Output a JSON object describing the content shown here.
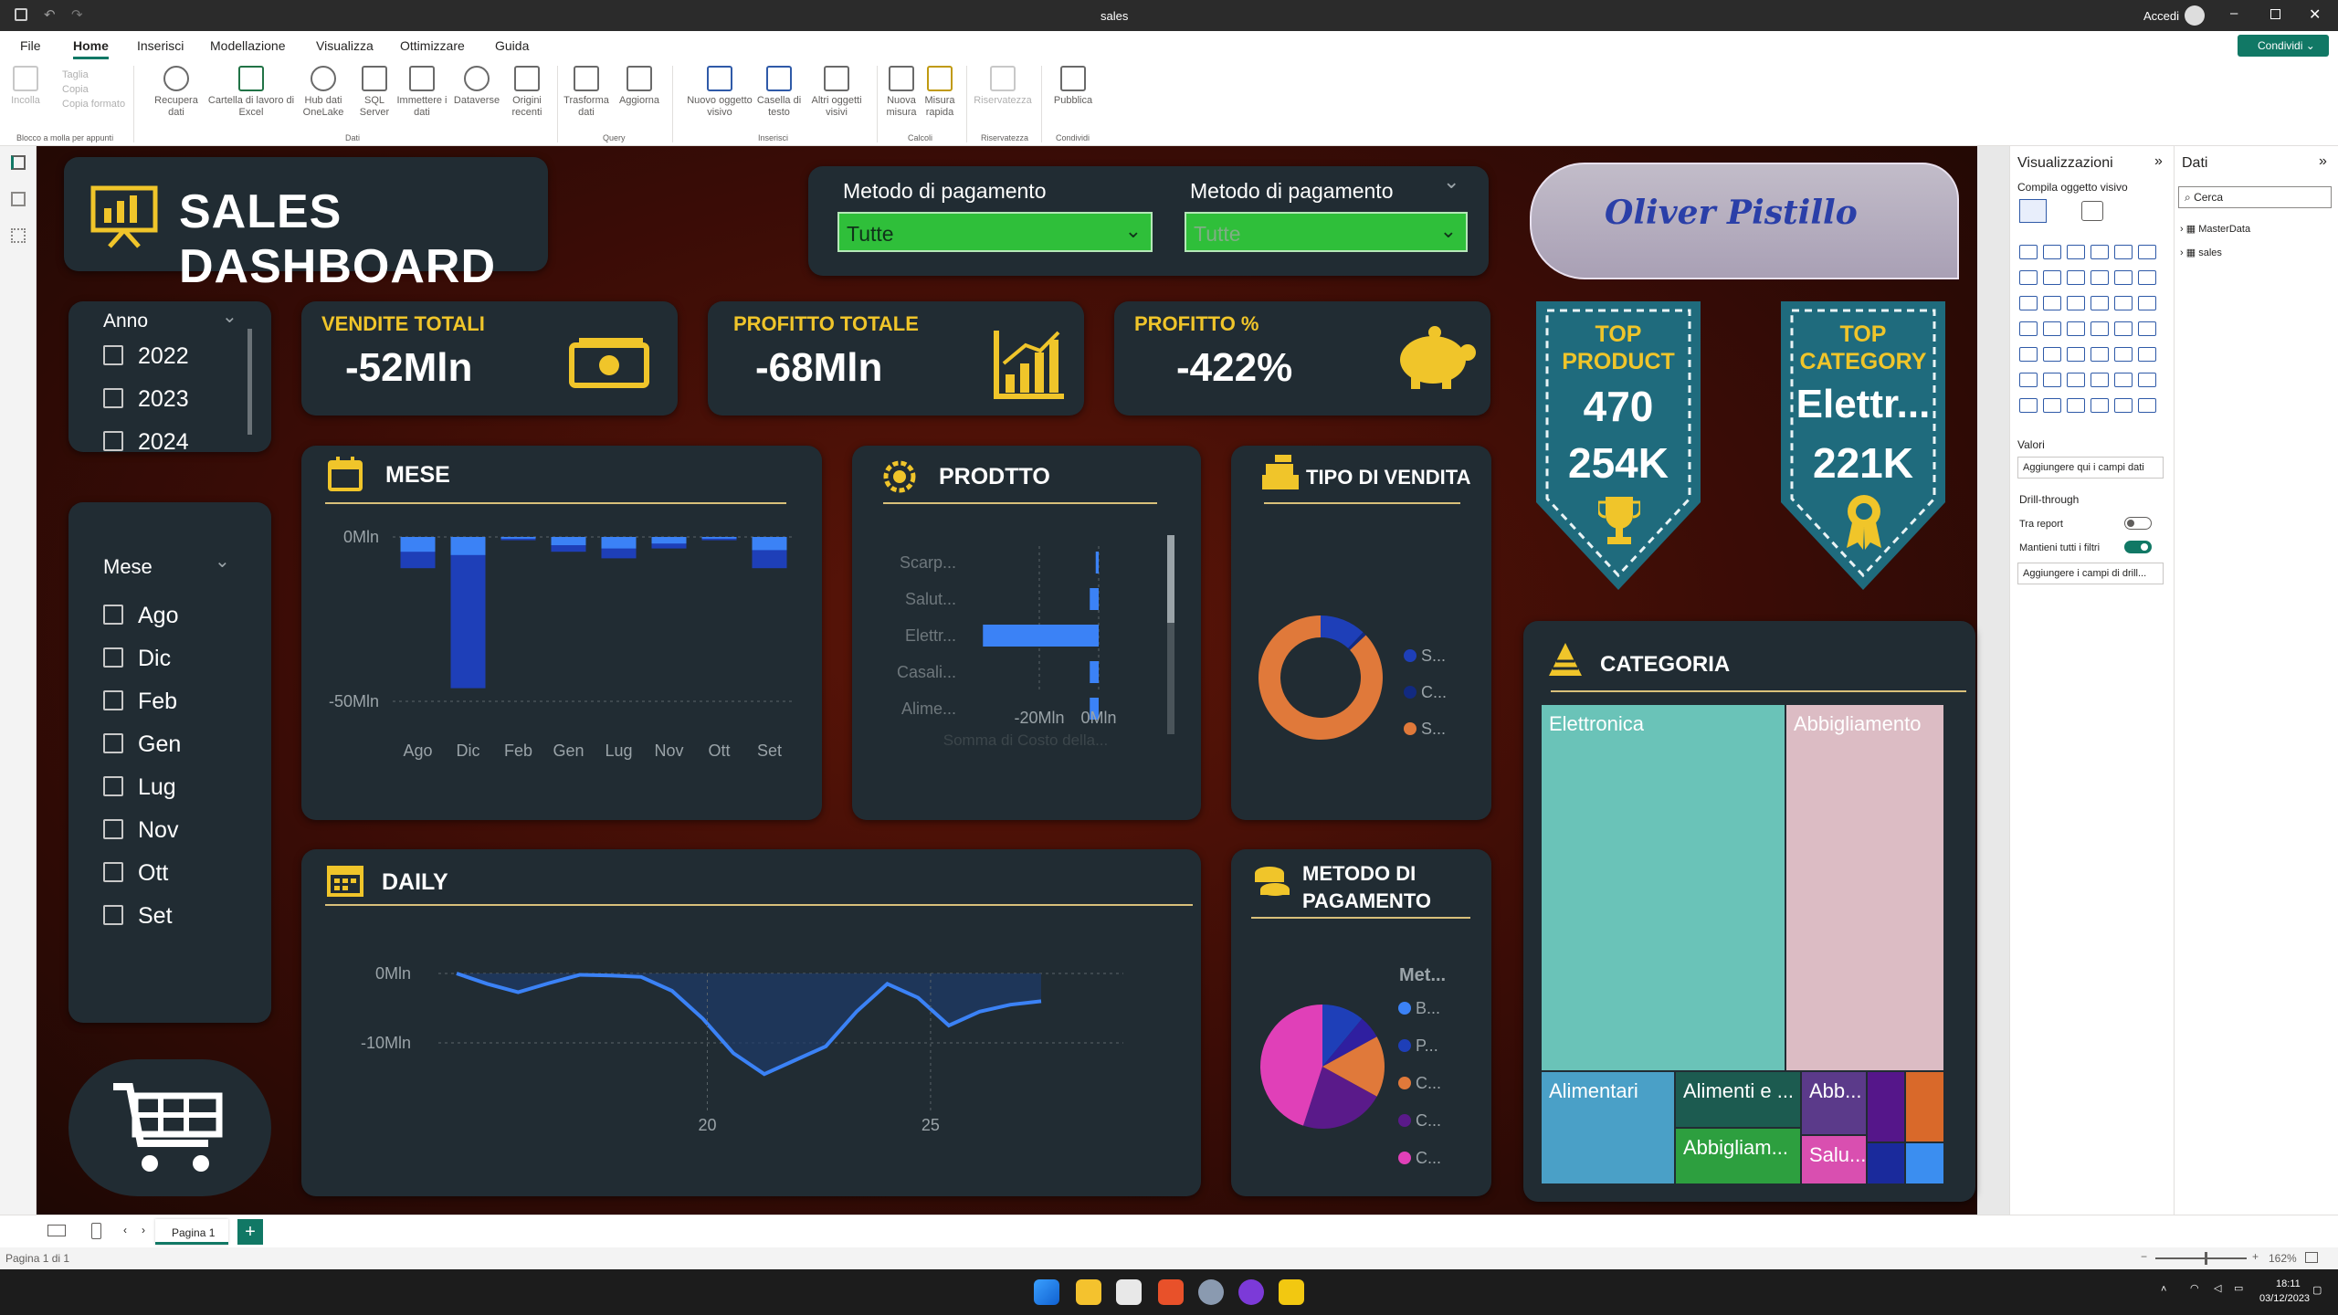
{
  "window": {
    "title": "sales",
    "signin": "Accedi"
  },
  "menu": {
    "file": "File",
    "home": "Home",
    "insert": "Inserisci",
    "modeling": "Modellazione",
    "view": "Visualizza",
    "optimize": "Ottimizzare",
    "help": "Guida",
    "share": "Condividi"
  },
  "ribbon": {
    "clipboard": {
      "paste": "Incolla",
      "cut": "Taglia",
      "copy": "Copia",
      "format": "Copia formato",
      "group": "Blocco a molla per appunti"
    },
    "data": {
      "get": "Recupera dati",
      "excel": "Cartella di lavoro di Excel",
      "onelake": "Hub dati OneLake",
      "sql": "SQL Server",
      "enter": "Immettere i dati",
      "dataverse": "Dataverse",
      "recent": "Origini recenti",
      "group": "Dati"
    },
    "query": {
      "transform": "Trasforma dati",
      "refresh": "Aggiorna",
      "group": "Query"
    },
    "insert": {
      "visual": "Nuovo oggetto visivo",
      "textbox": "Casella di testo",
      "more": "Altri oggetti visivi",
      "group": "Inserisci"
    },
    "calc": {
      "measure": "Nuova misura",
      "quick": "Misura rapida",
      "group": "Calcoli"
    },
    "sens": {
      "label": "Riservatezza",
      "group": "Riservatezza"
    },
    "share": {
      "publish": "Pubblica",
      "group": "Condividi"
    }
  },
  "dashboard": {
    "title": "SALES DASHBOARD",
    "author": "Oliver Pistillo",
    "slicer_payment1": {
      "label": "Metodo di pagamento",
      "value": "Tutte"
    },
    "slicer_payment2": {
      "label": "Metodo di pagamento",
      "value": "Tutte"
    },
    "year_slicer": {
      "label": "Anno",
      "items": [
        "2022",
        "2023",
        "2024"
      ]
    },
    "month_slicer": {
      "label": "Mese",
      "items": [
        "Ago",
        "Dic",
        "Feb",
        "Gen",
        "Lug",
        "Nov",
        "Ott",
        "Set"
      ]
    },
    "kpis": [
      {
        "title": "VENDITE TOTALI",
        "value": "-52Mln"
      },
      {
        "title": "PROFITTO TOTALE",
        "value": "-68Mln"
      },
      {
        "title": "PROFITTO %",
        "value": "-422%"
      }
    ],
    "top_product": {
      "line1": "TOP",
      "line2": "PRODUCT",
      "id": "470",
      "value": "254K"
    },
    "top_category": {
      "line1": "TOP",
      "line2": "CATEGORY",
      "name": "Elettr...",
      "value": "221K"
    },
    "visuals": {
      "mese": "MESE",
      "prodotto": "PRODTTO",
      "tipo": "TIPO DI VENDITA",
      "categoria": "CATEGORIA",
      "daily": "DAILY",
      "metodo": "METODO DI PAGAMENTO"
    },
    "tipo_legend": [
      "S...",
      "C...",
      "S..."
    ],
    "metodo_legend": {
      "title": "Met...",
      "items": [
        "B...",
        "P...",
        "C...",
        "C...",
        "C..."
      ]
    },
    "prod_xlabel": "Somma di Costo della..."
  },
  "colors": {
    "accent_gold": "#f0c52a",
    "bar_blue": "#3b82f6",
    "bar_dark": "#1e40af",
    "card_bg": "#212c33",
    "teal_badge": "#1f6b7d",
    "slicer_green": "#2fbf3a"
  },
  "chart_data": [
    {
      "type": "bar",
      "title": "MESE",
      "categories": [
        "Ago",
        "Dic",
        "Feb",
        "Gen",
        "Lug",
        "Nov",
        "Ott",
        "Set"
      ],
      "series": [
        {
          "values": [
            -4.5,
            -5.5,
            -0.5,
            -2.5,
            -3.5,
            -2.0,
            -0.5,
            -4.0
          ]
        },
        {
          "values": [
            -9.5,
            -46,
            -1,
            -4.5,
            -6.5,
            -3.5,
            -1,
            -9.5
          ]
        }
      ],
      "ylim": [
        -50,
        0
      ],
      "yticks": [
        "0Mln",
        "-50Mln"
      ]
    },
    {
      "type": "bar",
      "title": "PRODTTO",
      "categories": [
        "Scarp...",
        "Salut...",
        "Elettr...",
        "Casali...",
        "Alime..."
      ],
      "values": [
        -1,
        -3,
        -39,
        -3,
        -3
      ],
      "xticks": [
        "-20Mln",
        "0Mln"
      ],
      "xlabel": "Somma di Costo della..."
    },
    {
      "type": "line",
      "title": "DAILY",
      "x": [
        10,
        11,
        12,
        13,
        14,
        15,
        16,
        17,
        18,
        19,
        20,
        21,
        22,
        23,
        24,
        25,
        26,
        27,
        28
      ],
      "y": [
        0,
        -1.5,
        -2.7,
        -1.4,
        -0.2,
        -0.3,
        -0.5,
        -2.5,
        -6.5,
        -11.5,
        -14.5,
        -12.5,
        -10.5,
        -5.5,
        -1.5,
        -3.5,
        -7.5,
        -5.5,
        -4.5,
        -4.0
      ],
      "ylim": [
        -14.5,
        0
      ],
      "yticks": [
        "0Mln",
        "-10Mln"
      ],
      "xticks": [
        "20",
        "25"
      ]
    },
    {
      "type": "pie",
      "title": "TIPO DI VENDITA",
      "labels": [
        "S...",
        "C...",
        "S..."
      ],
      "values": [
        12,
        1,
        87
      ],
      "colors": [
        "#1e3fb8",
        "#122a80",
        "#e0793a"
      ]
    },
    {
      "type": "pie",
      "title": "METODO DI PAGAMENTO",
      "labels": [
        "B...",
        "P...",
        "C...",
        "C...",
        "C..."
      ],
      "values": [
        11,
        6,
        16,
        22,
        45
      ],
      "colors": [
        "#1e3fb8",
        "#2f1fa0",
        "#e0793a",
        "#5a1a8a",
        "#e040b8"
      ]
    },
    {
      "type": "heatmap",
      "title": "CATEGORIA",
      "labels": [
        "Elettronica",
        "Abbigliamento",
        "Alimentari",
        "Alimenti e ...",
        "Abbigliam...",
        "Abb...",
        "Salu..."
      ]
    }
  ],
  "panels": {
    "viz_title": "Visualizzazioni",
    "viz_sub": "Compila oggetto visivo",
    "data_title": "Dati",
    "search": "Cerca",
    "tables": [
      "MasterData",
      "sales"
    ],
    "values_label": "Valori",
    "values_placeholder": "Aggiungere qui i campi dati",
    "drill": "Drill-through",
    "cross_report": "Tra report",
    "keep_filters": "Mantieni tutti i filtri",
    "drill_placeholder": "Aggiungere i campi di drill..."
  },
  "pages": {
    "page1": "Pagina 1",
    "status": "Pagina 1 di 1",
    "zoom": "162%"
  },
  "taskbar": {
    "time": "18:11",
    "date": "03/12/2023"
  }
}
